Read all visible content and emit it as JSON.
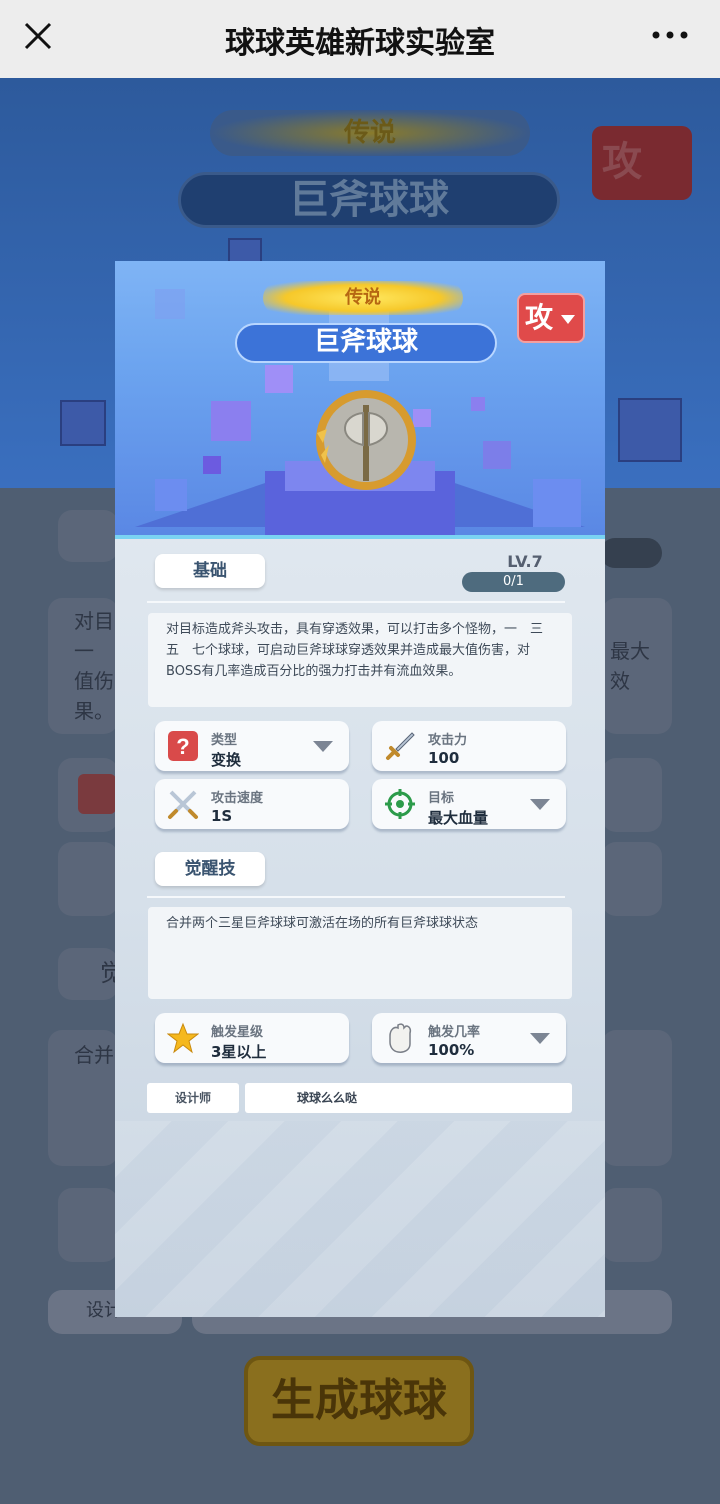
{
  "nav": {
    "title": "球球英雄新球实验室"
  },
  "background": {
    "legend": "传说",
    "name": "巨斧球球",
    "attack": "攻",
    "desc_frag1": "对目",
    "desc_frag2": "一",
    "desc_frag3": "值伤",
    "desc_frag4": "果。",
    "desc_frag5": "最大",
    "desc_frag6": "效",
    "awaken_frag": "觉",
    "merge_frag": "合并",
    "designer_frag": "设计",
    "generate": "生成球球"
  },
  "card": {
    "rarity": "传说",
    "name": "巨斧球球",
    "attack_type": "攻",
    "basic_label": "基础",
    "level": "LV.7",
    "progress_text": "0/1",
    "progress": 0,
    "description": "对目标造成斧头攻击，具有穿透效果，可以打击多个怪物，一　三　五　七个球球，可启动巨斧球球穿透效果并造成最大值伤害，对BOSS有几率造成百分比的强力打击并有流血效果。",
    "fields": {
      "type": {
        "label": "类型",
        "value": "变换"
      },
      "attack": {
        "label": "攻击力",
        "value": "100"
      },
      "speed": {
        "label": "攻击速度",
        "value": "1S"
      },
      "target": {
        "label": "目标",
        "value": "最大血量"
      }
    },
    "awaken_label": "觉醒技",
    "awaken_desc": "合并两个三星巨斧球球可激活在场的所有巨斧球球状态",
    "trigger_star": {
      "label": "触发星级",
      "value": "3星以上"
    },
    "trigger_rate": {
      "label": "触发几率",
      "value": "100%"
    },
    "designer_label": "设计师",
    "designer_name": "球球么么哒"
  },
  "colors": {
    "accent": "#3c73d8",
    "attack": "#e04a4a",
    "legend": "#f6c82a"
  },
  "icons": [
    "close-icon",
    "more-icon",
    "question-icon",
    "sword-icon",
    "crossed-swords-icon",
    "target-icon",
    "star-icon",
    "glove-icon",
    "axe-emblem-icon",
    "dropdown-icon"
  ]
}
